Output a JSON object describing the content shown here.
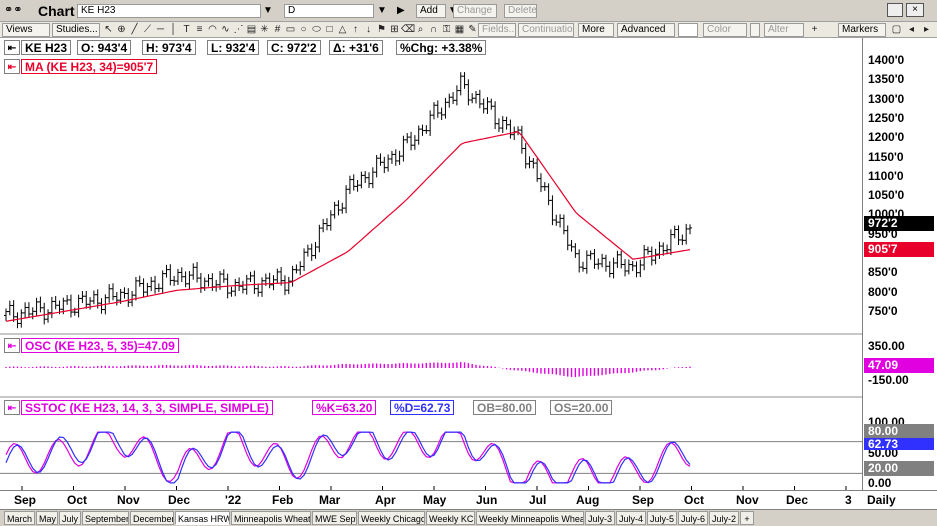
{
  "window": {
    "title": "Chart",
    "symbol_field": "KE H23",
    "interval_field": "D"
  },
  "toolbar": {
    "add_label": "Add",
    "change_label": "Change",
    "delete_label": "Delete",
    "views_label": "Views",
    "studies_label": "Studies...",
    "fields_label": "Fields...",
    "continuation_label": "Continuation",
    "more_label": "More",
    "advanced_label": "Advanced",
    "color_label": "Color",
    "alter_label": "Alter",
    "markers_label": "Markers"
  },
  "header": {
    "symbol": "KE H23",
    "open": "O: 943'4",
    "high": "H: 973'4",
    "low": "L: 932'4",
    "close": "C: 972'2",
    "change": "Δ: +31'6",
    "pct_change": "%Chg: +3.38%",
    "ma_label": "MA (KE H23, 34)=905'7",
    "osc_label": "OSC (KE H23, 5, 35)=47.09",
    "sstoc_label": "SSTOC (KE H23, 14, 3, 3, SIMPLE, SIMPLE)",
    "pct_k": "%K=63.20",
    "pct_d": "%D=62.73",
    "ob": "OB=80.00",
    "os": "OS=20.00"
  },
  "price_axis": [
    "1400'0",
    "1350'0",
    "1300'0",
    "1250'0",
    "1200'0",
    "1150'0",
    "1100'0",
    "1050'0",
    "1000'0",
    "950'0",
    "850'0",
    "800'0",
    "750'0"
  ],
  "price_tags": {
    "last": "972'2",
    "ma": "905'7"
  },
  "osc_axis": [
    "350.00",
    "-150.00"
  ],
  "osc_tag": "47.09",
  "stoch_axis": [
    "100.00",
    "50.00",
    "0.00"
  ],
  "stoch_tags": {
    "ob": "80.00",
    "k": "62.73",
    "os": "20.00"
  },
  "months": [
    "Sep",
    "Oct",
    "Nov",
    "Dec",
    "'22",
    "Feb",
    "Mar",
    "Apr",
    "May",
    "Jun",
    "Jul",
    "Aug",
    "Sep",
    "Oct",
    "Nov",
    "Dec",
    "3",
    "Daily"
  ],
  "tabs": [
    "March",
    "May",
    "July",
    "September",
    "December",
    "Kansas HRW",
    "Minneapolis Wheat",
    "MWE Sept",
    "Weekly Chicago",
    "Weekly KC",
    "Weekly Minneapolis Wheat",
    "July-3",
    "July-4",
    "July-5",
    "July-6",
    "July-2",
    "+"
  ],
  "colors": {
    "price": "#000000",
    "ma": "#e8002a",
    "osc": "#e000e0",
    "k": "#3030ff",
    "d": "#e000e0",
    "ref": "#808080"
  },
  "chart_data": {
    "type": "bar",
    "price": {
      "x_months": [
        "Sep",
        "Oct",
        "Nov",
        "Dec",
        "Jan",
        "Feb",
        "Mar",
        "Apr",
        "May",
        "Jun",
        "Jul",
        "Aug",
        "Sep"
      ],
      "close": [
        735,
        760,
        785,
        840,
        810,
        830,
        1060,
        1170,
        1330,
        1190,
        880,
        860,
        960
      ],
      "ma34": [
        720,
        745,
        770,
        800,
        812,
        820,
        900,
        1030,
        1180,
        1210,
        1000,
        880,
        905
      ]
    },
    "osc": {
      "values": [
        15,
        20,
        30,
        40,
        30,
        20,
        55,
        65,
        80,
        -40,
        -130,
        -60,
        25
      ]
    },
    "stoch": {
      "k": [
        40,
        60,
        90,
        20,
        85,
        30,
        88,
        70,
        95,
        10,
        15,
        20,
        63
      ],
      "d": [
        45,
        55,
        85,
        25,
        80,
        35,
        85,
        72,
        90,
        12,
        18,
        22,
        63
      ],
      "ob": 80,
      "os": 20
    }
  }
}
